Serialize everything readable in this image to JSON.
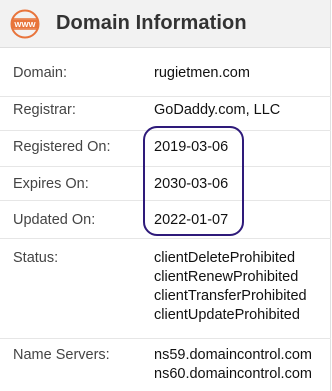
{
  "header": {
    "icon_text": "WWW",
    "title": "Domain Information"
  },
  "rows": [
    {
      "label": "Domain:",
      "values": [
        "rugietmen.com"
      ]
    },
    {
      "label": "Registrar:",
      "values": [
        "GoDaddy.com, LLC"
      ]
    },
    {
      "label": "Registered On:",
      "values": [
        "2019-03-06"
      ]
    },
    {
      "label": "Expires On:",
      "values": [
        "2030-03-06"
      ]
    },
    {
      "label": "Updated On:",
      "values": [
        "2022-01-07"
      ]
    },
    {
      "label": "Status:",
      "values": [
        "clientDeleteProhibited",
        "clientRenewProhibited",
        "clientTransferProhibited",
        "clientUpdateProhibited"
      ]
    },
    {
      "label": "Name Servers:",
      "values": [
        "ns59.domaincontrol.com",
        "ns60.domaincontrol.com"
      ]
    }
  ],
  "colors": {
    "accent": "#e8743b",
    "highlight_border": "#2e1a7a",
    "header_bg": "#f2f2f2"
  }
}
